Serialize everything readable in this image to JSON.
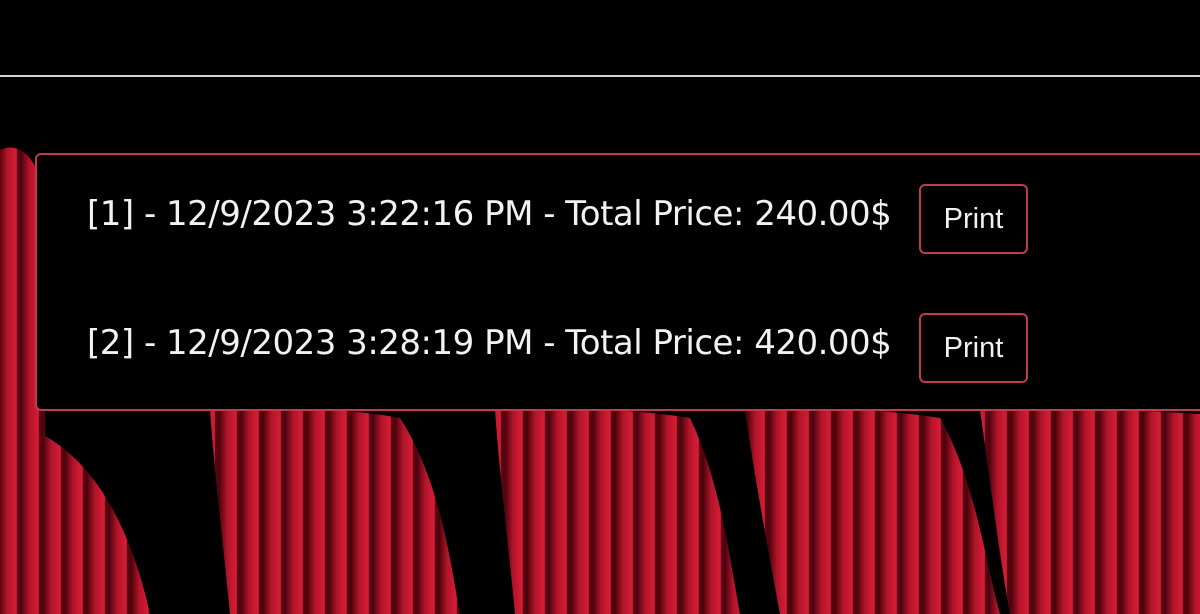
{
  "orders": [
    {
      "id": "[1]",
      "datetime": "12/9/2023 3:22:16 PM",
      "price_label": "Total Price:",
      "price": "240.00$",
      "line": "[1] - 12/9/2023 3:22:16 PM - Total Price: 240.00$",
      "print_label": "Print"
    },
    {
      "id": "[2]",
      "datetime": "12/9/2023 3:28:19 PM",
      "price_label": "Total Price:",
      "price": "420.00$",
      "line": "[2] - 12/9/2023 3:28:19 PM - Total Price: 420.00$",
      "print_label": "Print"
    }
  ],
  "colors": {
    "background": "#000000",
    "accent_border": "#c23a4d",
    "text": "#f2f2f2",
    "seat_red": "#b5142a"
  }
}
